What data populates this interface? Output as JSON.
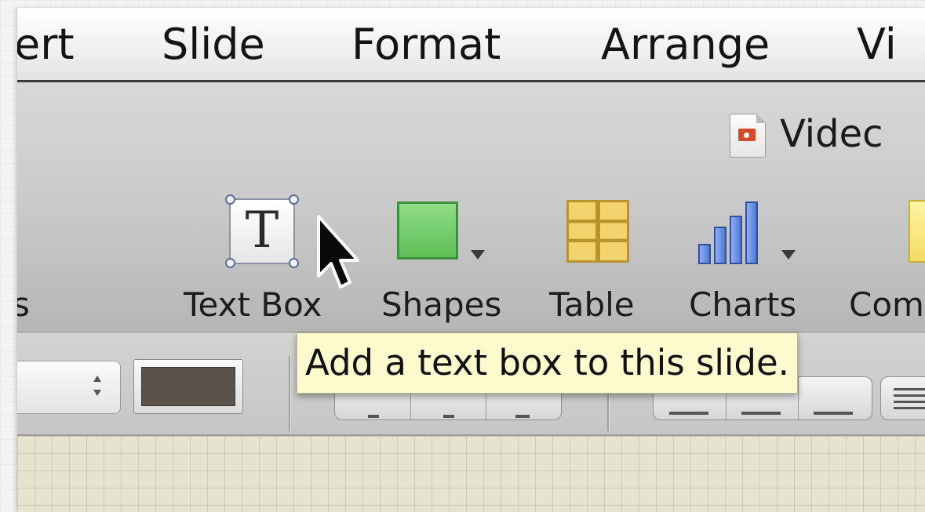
{
  "menu": {
    "items": [
      "ert",
      "Slide",
      "Format",
      "Arrange",
      "Vi"
    ]
  },
  "document": {
    "title": "Videc",
    "icon": "keynote-video-document-icon"
  },
  "toolbar": {
    "partial_left_label": "s",
    "buttons": [
      {
        "label": "Text Box",
        "icon": "text-box-icon"
      },
      {
        "label": "Shapes",
        "icon": "shapes-icon"
      },
      {
        "label": "Table",
        "icon": "table-icon"
      },
      {
        "label": "Charts",
        "icon": "charts-icon"
      },
      {
        "label": "Com",
        "icon": "comment-icon"
      }
    ]
  },
  "tooltip": {
    "text": "Add a text box to this slide."
  },
  "format_bar": {
    "color_swatch": "#5b524c"
  },
  "colors": {
    "tooltip_bg": "#fdfbce",
    "shapes_green": "#6cc864",
    "table_yellow": "#f2d36e",
    "charts_blue": "#5a82dc"
  }
}
